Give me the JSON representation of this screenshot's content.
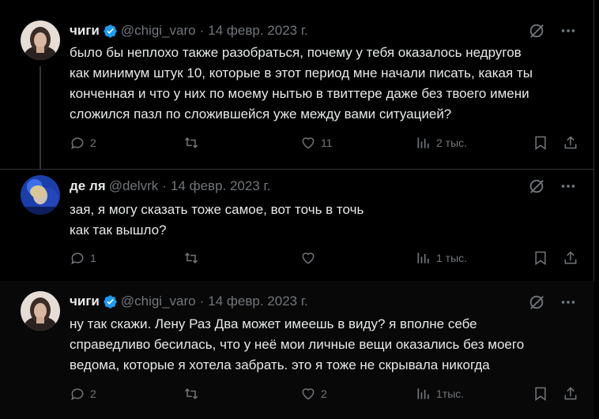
{
  "tweets": [
    {
      "name": "чиги",
      "handle": "@chigi_varo",
      "date": "14 февр. 2023 г.",
      "verified": true,
      "lines": [
        "было бы неплохо также разобраться, почему у тебя оказалось недругов",
        "как минимум штук 10, которые в этот период мне начали писать, какая ты",
        "конченная и что у них по моему нытью в твиттере даже без твоего имени",
        "сложился пазл по сложившейся уже между вами ситуацией?"
      ],
      "replies": "2",
      "retweets": "",
      "likes": "11",
      "views": "2 тыс."
    },
    {
      "name": "де ля",
      "handle": "@delvrk",
      "date": "14 февр. 2023 г.",
      "verified": false,
      "lines": [
        "зая, я могу сказать тоже самое, вот точь в точь",
        "как так вышло?"
      ],
      "replies": "1",
      "retweets": "",
      "likes": "",
      "views": "1 тыс."
    },
    {
      "name": "чиги",
      "handle": "@chigi_varo",
      "date": "14 февр. 2023 г.",
      "verified": true,
      "lines": [
        "ну так скажи. Лену Раз Два может имеешь в виду? я вполне себе",
        "справедливо бесилась, что у неё мои личные вещи оказались без моего",
        "ведома, которые я хотела забрать. это я тоже не скрывала никогда"
      ],
      "replies": "2",
      "retweets": "",
      "likes": "2",
      "views": "1тыс."
    }
  ],
  "colors": {
    "background": "#000000",
    "text": "#e7e9ea",
    "muted": "#71767b",
    "verified": "#1d9bf0",
    "divider": "#2f3336"
  },
  "icons": {
    "grok": "grok-icon",
    "more": "more-icon",
    "reply": "reply-icon",
    "retweet": "retweet-icon",
    "like": "like-icon",
    "views": "views-icon",
    "bookmark": "bookmark-icon",
    "share": "share-icon"
  }
}
